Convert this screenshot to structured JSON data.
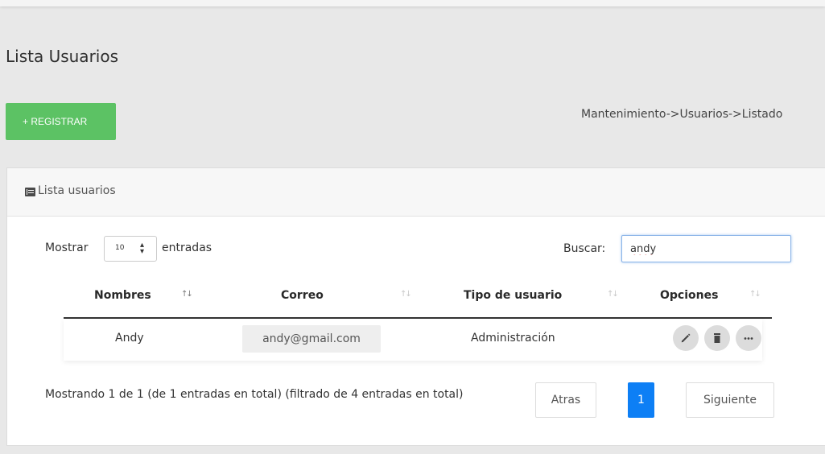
{
  "page": {
    "title": "Lista Usuarios",
    "register_button": "+ REGISTRAR",
    "breadcrumb": "Mantenimiento->Usuarios->Listado"
  },
  "card": {
    "title": "Lista usuarios",
    "icon": "list-icon"
  },
  "table_controls": {
    "show_label": "Mostrar",
    "page_length": "10",
    "entries_label": "entradas",
    "search_label": "Buscar:",
    "search_value": "andy"
  },
  "table": {
    "columns": [
      "Nombres",
      "Correo",
      "Tipo de usuario",
      "Opciones"
    ],
    "rows": [
      {
        "nombre": "Andy",
        "correo": "andy@gmail.com",
        "tipo": "Administración"
      }
    ],
    "row_actions": [
      "edit-icon",
      "delete-icon",
      "more-icon"
    ]
  },
  "footer": {
    "info": "Mostrando 1 de 1 (de 1 entradas en total) (filtrado de 4 entradas en total)",
    "prev_label": "Atras",
    "current_page": "1",
    "next_label": "Siguiente"
  },
  "colors": {
    "register_button": "#5cc264",
    "active_page": "#0d7ff5",
    "background": "#e8e8e8"
  }
}
